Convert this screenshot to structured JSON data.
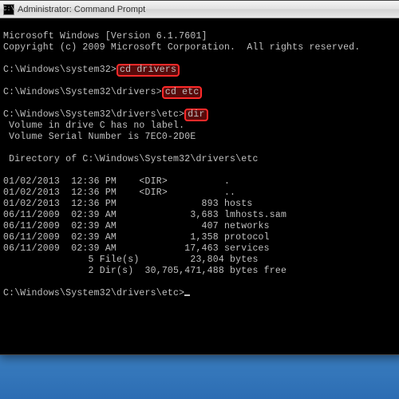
{
  "window": {
    "title": "Administrator: Command Prompt",
    "icon_glyph": "C:\\"
  },
  "term": {
    "banner1": "Microsoft Windows [Version 6.1.7601]",
    "banner2": "Copyright (c) 2009 Microsoft Corporation.  All rights reserved.",
    "p1_prompt": "C:\\Windows\\system32>",
    "p1_cmd": "cd drivers",
    "p2_prompt": "C:\\Windows\\System32\\drivers>",
    "p2_cmd": "cd etc",
    "p3_prompt": "C:\\Windows\\System32\\drivers\\etc>",
    "p3_cmd": "dir",
    "vol1": " Volume in drive C has no label.",
    "vol2": " Volume Serial Number is 7EC0-2D0E",
    "dirof": " Directory of C:\\Windows\\System32\\drivers\\etc",
    "r1": "01/02/2013  12:36 PM    <DIR>          .",
    "r2": "01/02/2013  12:36 PM    <DIR>          ..",
    "r3": "01/02/2013  12:36 PM               893 hosts",
    "r4": "06/11/2009  02:39 AM             3,683 lmhosts.sam",
    "r5": "06/11/2009  02:39 AM               407 networks",
    "r6": "06/11/2009  02:39 AM             1,358 protocol",
    "r7": "06/11/2009  02:39 AM            17,463 services",
    "sum1": "               5 File(s)         23,804 bytes",
    "sum2": "               2 Dir(s)  30,705,471,488 bytes free",
    "p4_prompt": "C:\\Windows\\System32\\drivers\\etc>"
  }
}
